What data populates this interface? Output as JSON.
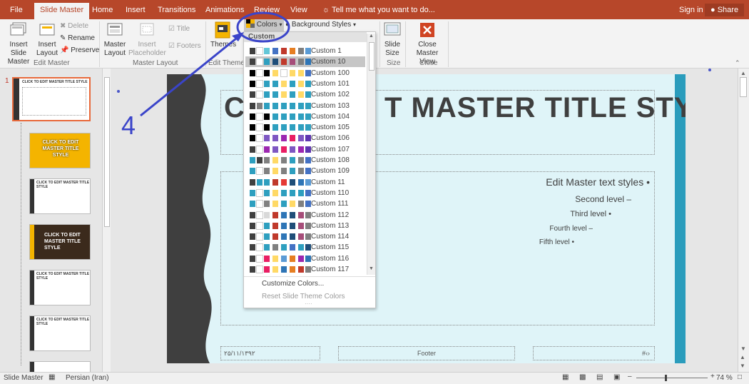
{
  "tabs": [
    "File",
    "Slide Master",
    "Home",
    "Insert",
    "Transitions",
    "Animations",
    "Review",
    "View"
  ],
  "tell_me": "Tell me what you want to do...",
  "sign_in": "Sign in",
  "share": "Share",
  "ribbon": {
    "insert_slide_master": "Insert Slide Master",
    "insert_layout": "Insert Layout",
    "delete": "Delete",
    "rename": "Rename",
    "preserve": "Preserve",
    "edit_master_group": "Edit Master",
    "master_layout": "Master Layout",
    "insert_placeholder": "Insert Placeholder",
    "title_check": "Title",
    "footers_check": "Footers",
    "master_layout_group": "Master Layout",
    "themes": "Themes",
    "edit_theme_group": "Edit Theme",
    "colors": "Colors",
    "background_styles": "Background Styles",
    "slide_size": "Slide Size",
    "size_group": "Size",
    "close_master_view": "Close Master View",
    "close_group": "Close"
  },
  "annotation": "4",
  "colors_menu": {
    "header": "Custom",
    "items": [
      {
        "label": "Custom 1",
        "colors": [
          "#404040",
          "#ffffff",
          "#63c7d8",
          "#4472c4",
          "#c0392b",
          "#e67e22",
          "#7f7f7f",
          "#5b9bd5"
        ]
      },
      {
        "label": "Custom 10",
        "colors": [
          "#404040",
          "#ffffff",
          "#2e9fbf",
          "#1f4e79",
          "#c0392b",
          "#a64d79",
          "#808080",
          "#2e75b6"
        ]
      },
      {
        "label": "Custom 100",
        "colors": [
          "#000000",
          "#ffffff",
          "#000000",
          "#ffd966",
          "#ffffff",
          "#ffd966",
          "#ffd966",
          "#4472c4"
        ]
      },
      {
        "label": "Custom 101",
        "colors": [
          "#000000",
          "#ffffff",
          "#2e9fbf",
          "#2e9fbf",
          "#ffd966",
          "#2e9fbf",
          "#ffd966",
          "#2e9fbf"
        ]
      },
      {
        "label": "Custom 102",
        "colors": [
          "#404040",
          "#ffffff",
          "#2e9fbf",
          "#2e9fbf",
          "#ffd966",
          "#2e9fbf",
          "#ffd966",
          "#2e9fbf"
        ]
      },
      {
        "label": "Custom 103",
        "colors": [
          "#404040",
          "#808080",
          "#2e9fbf",
          "#2e9fbf",
          "#2e9fbf",
          "#2e9fbf",
          "#2e9fbf",
          "#2e9fbf"
        ]
      },
      {
        "label": "Custom 104",
        "colors": [
          "#000000",
          "#ffffff",
          "#000000",
          "#2e9fbf",
          "#2e9fbf",
          "#2e9fbf",
          "#2e9fbf",
          "#2e9fbf"
        ]
      },
      {
        "label": "Custom 105",
        "colors": [
          "#000000",
          "#ffffff",
          "#000000",
          "#2e9fbf",
          "#2e9fbf",
          "#2e9fbf",
          "#2e9fbf",
          "#2e9fbf"
        ]
      },
      {
        "label": "Custom 106",
        "colors": [
          "#000000",
          "#ffffff",
          "#7e57c2",
          "#7e57c2",
          "#9c27b0",
          "#e91e63",
          "#7e57c2",
          "#5e35b1"
        ]
      },
      {
        "label": "Custom 107",
        "colors": [
          "#404040",
          "#ffffff",
          "#9c27b0",
          "#7e57c2",
          "#e91e63",
          "#7e57c2",
          "#9c27b0",
          "#5e35b1"
        ]
      },
      {
        "label": "Custom 108",
        "colors": [
          "#2e9fbf",
          "#404040",
          "#808080",
          "#ffd966",
          "#808080",
          "#2e9fbf",
          "#808080",
          "#4472c4"
        ]
      },
      {
        "label": "Custom 109",
        "colors": [
          "#2e9fbf",
          "#ffffff",
          "#808080",
          "#ffd966",
          "#808080",
          "#2e9fbf",
          "#808080",
          "#4472c4"
        ]
      },
      {
        "label": "Custom 11",
        "colors": [
          "#404040",
          "#2e9fbf",
          "#2e9fbf",
          "#c0392b",
          "#e53935",
          "#1f4e79",
          "#2e75b6",
          "#5b9bd5"
        ]
      },
      {
        "label": "Custom 110",
        "colors": [
          "#2e9fbf",
          "#ffffff",
          "#2e9fbf",
          "#ffd966",
          "#2e9fbf",
          "#2e9fbf",
          "#2e9fbf",
          "#4472c4"
        ]
      },
      {
        "label": "Custom 111",
        "colors": [
          "#2e9fbf",
          "#ffffff",
          "#808080",
          "#ffd966",
          "#2e9fbf",
          "#ffd966",
          "#808080",
          "#4472c4"
        ]
      },
      {
        "label": "Custom 112",
        "colors": [
          "#404040",
          "#ffffff",
          "#d9d9d9",
          "#c0392b",
          "#2e75b6",
          "#1f4e79",
          "#a64d79",
          "#7f7f7f"
        ]
      },
      {
        "label": "Custom 113",
        "colors": [
          "#404040",
          "#ffffff",
          "#2e9fbf",
          "#c0392b",
          "#2e75b6",
          "#1f4e79",
          "#a64d79",
          "#7f7f7f"
        ]
      },
      {
        "label": "Custom 114",
        "colors": [
          "#404040",
          "#ffffff",
          "#2e9fbf",
          "#c0392b",
          "#2e75b6",
          "#1f4e79",
          "#a64d79",
          "#7f7f7f"
        ]
      },
      {
        "label": "Custom 115",
        "colors": [
          "#404040",
          "#ffffff",
          "#2e9fbf",
          "#808080",
          "#2e9fbf",
          "#4472c4",
          "#2e9fbf",
          "#1f4e79"
        ]
      },
      {
        "label": "Custom 116",
        "colors": [
          "#404040",
          "#ffffff",
          "#e91e63",
          "#ffd966",
          "#5b9bd5",
          "#e67e22",
          "#9c27b0",
          "#2e75b6"
        ]
      },
      {
        "label": "Custom 117",
        "colors": [
          "#404040",
          "#ffffff",
          "#e91e63",
          "#ffd966",
          "#2e75b6",
          "#e67e22",
          "#c0392b",
          "#7f7f7f"
        ]
      }
    ],
    "customize": "Customize Colors...",
    "reset": "Reset Slide Theme Colors"
  },
  "thumbs": [
    {
      "title": "CLICK TO EDIT MASTER TITLE STYLE",
      "theme": "white"
    },
    {
      "title": "CLICK TO EDIT MASTER TITLE STYLE",
      "theme": "orange"
    },
    {
      "title": "CLICK TO EDIT MASTER TITLE STYLE",
      "theme": "white"
    },
    {
      "title": "CLICK TO EDIT MASTER TITLE STYLE",
      "theme": "dark"
    },
    {
      "title": "CLICK TO EDIT MASTER TITLE STYLE",
      "theme": "white"
    },
    {
      "title": "CLICK TO EDIT MASTER TITLE STYLE",
      "theme": "white"
    },
    {
      "title": "",
      "theme": "white"
    }
  ],
  "thumb_number": "1",
  "slide": {
    "title_left": "CL",
    "title_right": "T MASTER TITLE STYLE",
    "level1": "Edit Master text styles",
    "level2": "Second level",
    "level3": "Third level",
    "level4": "Fourth level",
    "level5": "Fifth level",
    "date": "۲۵/۱۱/۱۳۹۲",
    "footer": "Footer",
    "number": "#‹›"
  },
  "status": {
    "view": "Slide Master",
    "language": "Persian (Iran)",
    "zoom": "74 %"
  }
}
